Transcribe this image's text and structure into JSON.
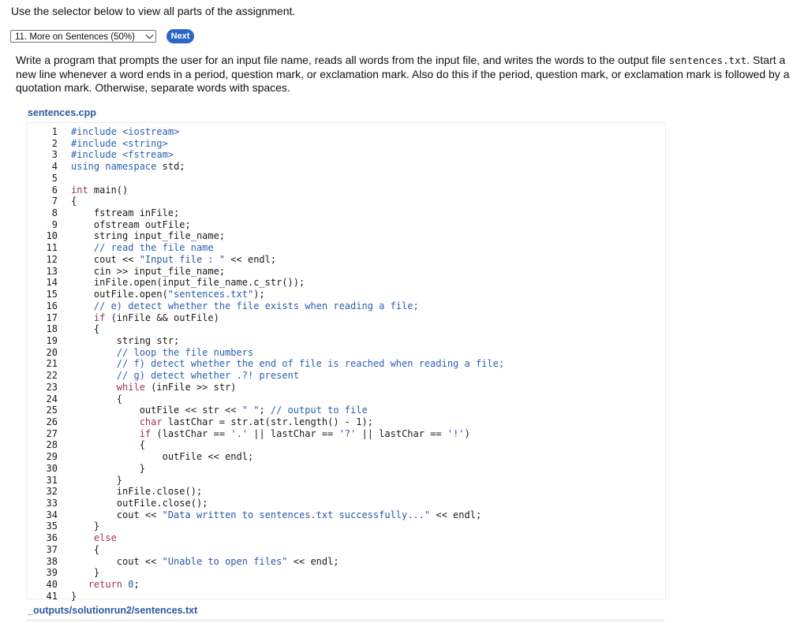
{
  "instructions": "Use the selector below to view all parts of the assignment.",
  "selector": {
    "selected": "11. More on Sentences (50%)"
  },
  "next_button": "Next",
  "description": {
    "part1": "Write a program that prompts the user for an input file name, reads all words from the input file, and writes the words to the output file ",
    "code": "sentences.txt",
    "part2": ". Start a new line whenever a word ends in a period, question mark, or exclamation mark. Also do this if the period, question mark, or exclamation mark is followed by a quotation mark. Otherwise, separate words with spaces."
  },
  "file_name": "sentences.cpp",
  "code_lines": [
    "#include <iostream>",
    "#include <string>",
    "#include <fstream>",
    "using namespace std;",
    "",
    "int main()",
    "{",
    "    fstream inFile;",
    "    ofstream outFile;",
    "    string input_file_name;",
    "    // read the file name",
    "    cout << \"Input file : \" << endl;",
    "    cin >> input_file_name;",
    "    inFile.open(input_file_name.c_str());",
    "    outFile.open(\"sentences.txt\");",
    "    // e) detect whether the file exists when reading a file;",
    "    if (inFile && outFile)",
    "    {",
    "        string str;",
    "        // loop the file numbers",
    "        // f) detect whether the end of file is reached when reading a file;",
    "        // g) detect whether .?! present",
    "        while (inFile >> str)",
    "        {",
    "            outFile << str << \" \"; // output to file",
    "            char lastChar = str.at(str.length() - 1);",
    "            if (lastChar == '.' || lastChar == '?' || lastChar == '!')",
    "            {",
    "                outFile << endl;",
    "            }",
    "        }",
    "        inFile.close();",
    "        outFile.close();",
    "        cout << \"Data written to sentences.txt successfully...\" << endl;",
    "    }",
    "    else",
    "    {",
    "        cout << \"Unable to open files\" << endl;",
    "    }",
    "   return 0;",
    "}"
  ],
  "output_label": "_outputs/solutionrun2/sentences.txt"
}
